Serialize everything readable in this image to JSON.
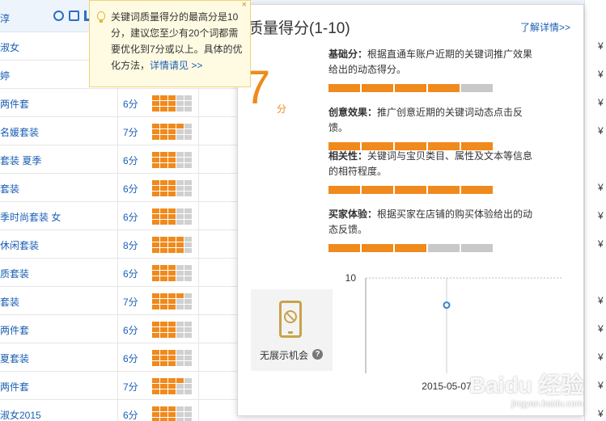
{
  "table": {
    "header": {
      "keyword_col_fragment": "淳"
    },
    "rows": [
      {
        "keyword": "淑女",
        "score": "",
        "filled": 0,
        "currency": "¥"
      },
      {
        "keyword": "婷",
        "score": "",
        "filled": 0,
        "currency": "¥"
      },
      {
        "keyword": "两件套",
        "score": "6分",
        "filled": 9,
        "currency": "¥"
      },
      {
        "keyword": "名媛套装",
        "score": "7分",
        "filled": 10,
        "currency": "¥"
      },
      {
        "keyword": "套装 夏季",
        "score": "6分",
        "filled": 9,
        "currency": ""
      },
      {
        "keyword": "套装",
        "score": "6分",
        "filled": 9,
        "currency": "¥"
      },
      {
        "keyword": "季时尚套装 女",
        "score": "6分",
        "filled": 9,
        "currency": "¥"
      },
      {
        "keyword": "休闲套装",
        "score": "8分",
        "filled": 12,
        "currency": "¥"
      },
      {
        "keyword": "质套装",
        "score": "6分",
        "filled": 9,
        "currency": ""
      },
      {
        "keyword": "套装",
        "score": "7分",
        "filled": 10,
        "currency": "¥"
      },
      {
        "keyword": "两件套",
        "score": "6分",
        "filled": 9,
        "currency": "¥"
      },
      {
        "keyword": "夏套装",
        "score": "6分",
        "filled": 9,
        "currency": "¥"
      },
      {
        "keyword": "两件套",
        "score": "7分",
        "filled": 10,
        "currency": "¥"
      },
      {
        "keyword": "淑女2015",
        "score": "6分",
        "filled": 9,
        "currency": "¥"
      }
    ]
  },
  "tooltip": {
    "text": "关键词质量得分的最高分是10分，建议您至少有20个词都需要优化到7分或以上。具体的优化方法，",
    "link": "详情请见 >>",
    "close": "×"
  },
  "card": {
    "title": "质量得分(1-10)",
    "more_link": "了解详情>>",
    "score": "7",
    "score_unit": "分",
    "metrics": [
      {
        "label": "基础分：",
        "desc": "根据直通车账户近期的关键词推广效果给出的动态得分。",
        "filled": 4
      },
      {
        "label": "创意效果：",
        "desc": "推广创意近期的关键词动态点击反馈。",
        "filled": 5
      },
      {
        "label": "相关性：",
        "desc": "关键词与宝贝类目、属性及文本等信息的相符程度。",
        "filled": 5
      },
      {
        "label": "买家体验：",
        "desc": "根据买家在店铺的购买体验给出的动态反馈。",
        "filled": 3
      }
    ],
    "no_show_label": "无展示机会",
    "help_icon_glyph": "?"
  },
  "chart_data": {
    "type": "line",
    "x": [
      "2015-05-07"
    ],
    "series": [
      {
        "values": [
          7
        ]
      }
    ],
    "y_tick_labels": [
      "10"
    ],
    "ylim": [
      0,
      10
    ],
    "title": "",
    "xlabel": "",
    "ylabel": ""
  },
  "watermark": {
    "main": "Baidu 经验",
    "sub": "jingyan.baidu.com"
  },
  "colors": {
    "accent": "#f08a1c",
    "link": "#1a5fb4",
    "bar_off": "#c8c8c8",
    "tip_bg": "#fffbe3"
  }
}
